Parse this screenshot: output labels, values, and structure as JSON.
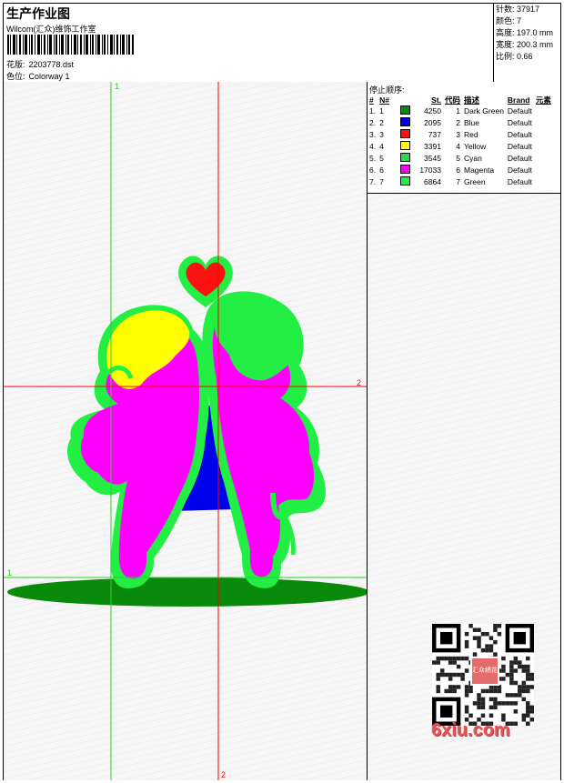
{
  "header": {
    "title": "生产作业图",
    "company": "Wilcom(汇众)维饰工作室",
    "design_label": "花版:",
    "design_value": "2203778.dst",
    "colorway_label": "色位:",
    "colorway_value": "Colorway 1"
  },
  "stats": [
    {
      "label": "针数:",
      "value": "37917"
    },
    {
      "label": "颜色:",
      "value": "7"
    },
    {
      "label": "高度:",
      "value": "197.0 mm"
    },
    {
      "label": "宽度:",
      "value": "200.3 mm"
    },
    {
      "label": "比例:",
      "value": "0.66"
    }
  ],
  "axes": {
    "top_label": "1",
    "right_label": "2",
    "bottom_label": "2",
    "left_label": "1"
  },
  "sequence": {
    "title": "停止顺序:",
    "columns": [
      "#",
      "N#",
      "St.",
      "代码",
      "描述",
      "Brand",
      "元素"
    ],
    "rows": [
      {
        "n": "1.",
        "nn": "1",
        "color": "#0a8a0a",
        "st": "4250",
        "code": "1",
        "desc": "Dark Green",
        "brand": "Default"
      },
      {
        "n": "2.",
        "nn": "2",
        "color": "#0000ee",
        "st": "2095",
        "code": "2",
        "desc": "Blue",
        "brand": "Default"
      },
      {
        "n": "3.",
        "nn": "3",
        "color": "#ff1010",
        "st": "737",
        "code": "3",
        "desc": "Red",
        "brand": "Default"
      },
      {
        "n": "4.",
        "nn": "4",
        "color": "#ffff00",
        "st": "3391",
        "code": "4",
        "desc": "Yellow",
        "brand": "Default"
      },
      {
        "n": "5.",
        "nn": "5",
        "color": "#22dd55",
        "st": "3545",
        "code": "5",
        "desc": "Cyan",
        "brand": "Default"
      },
      {
        "n": "6.",
        "nn": "6",
        "color": "#ff00ff",
        "st": "17033",
        "code": "6",
        "desc": "Magenta",
        "brand": "Default"
      },
      {
        "n": "7.",
        "nn": "7",
        "color": "#22ee44",
        "st": "6864",
        "code": "7",
        "desc": "Green",
        "brand": "Default"
      }
    ]
  },
  "watermark": {
    "seal_text": "汇众绣花",
    "brand": "6xiu.com"
  },
  "colors": {
    "guide_red": "#ff0000",
    "guide_green": "#33cc33",
    "ground": "#0a8a0a",
    "outline": "#22ee44",
    "body": "#ff00ff",
    "hair_left": "#ffff00",
    "hair_right": "#22ee44",
    "heart": "#ff1010",
    "wing_back": "#0000ee"
  }
}
